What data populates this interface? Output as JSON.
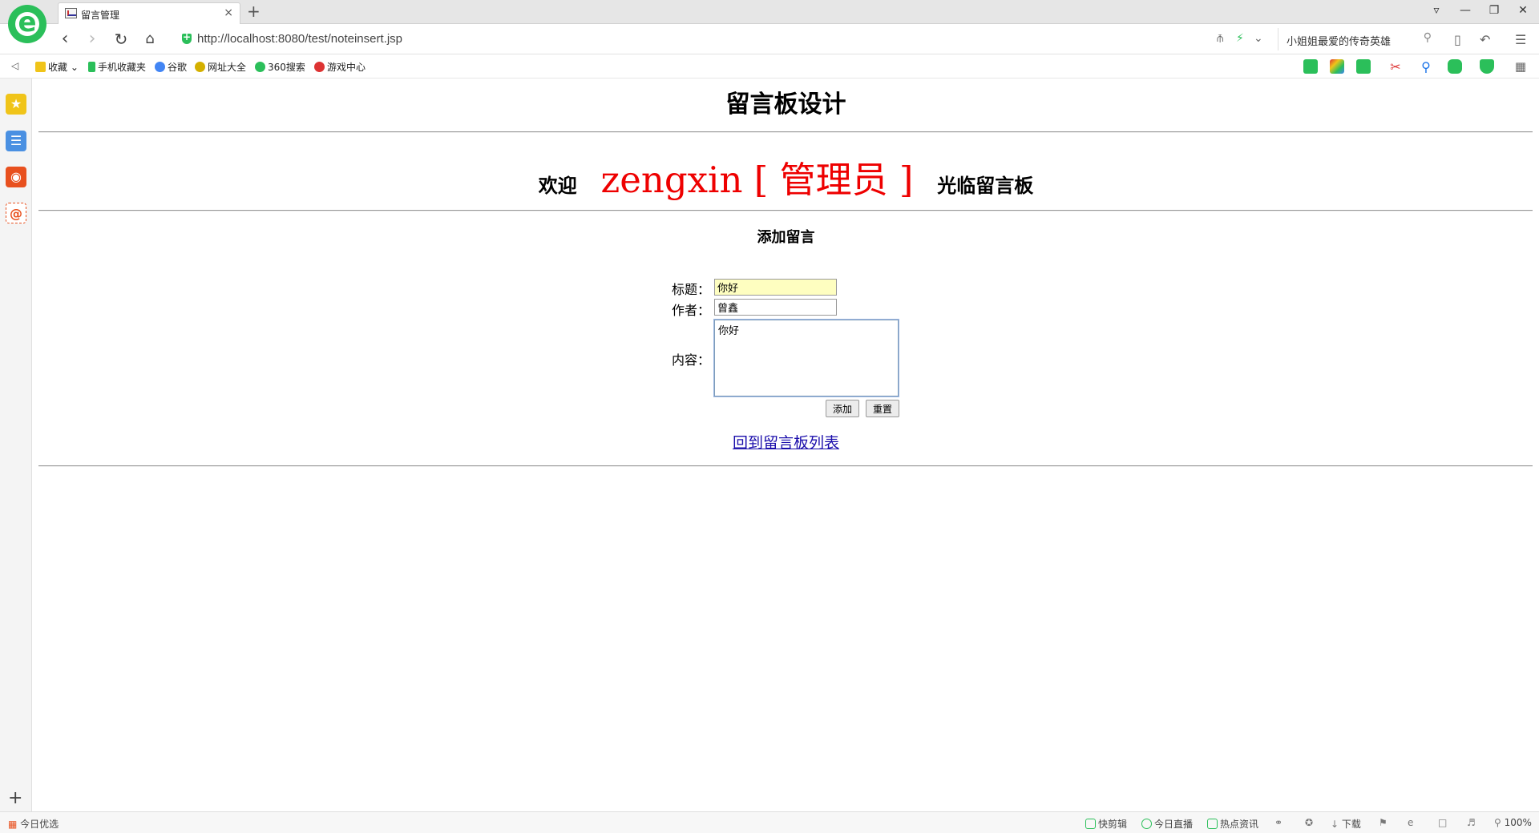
{
  "browser": {
    "tab": {
      "title": "留言管理",
      "close": "×"
    },
    "new_tab": "+",
    "url_host": "http://localhost",
    "url_rest": ":8080/test/noteinsert.jsp",
    "search_text": "小姐姐最爱的传奇英雄",
    "window_buttons": [
      "⌂",
      "—",
      "❐",
      "✕"
    ],
    "bookmarks": [
      "收藏",
      "手机收藏夹",
      "谷歌",
      "网址大全",
      "360搜索",
      "游戏中心"
    ],
    "bookmark_colors": [
      "#f0c419",
      "#2bbf5a",
      "#4285f4",
      "#d4b000",
      "#2bbf5a",
      "#d33"
    ],
    "status_left": "今日优选",
    "status_items": [
      "快剪辑",
      "今日直播",
      "热点资讯",
      "下载",
      "100%"
    ]
  },
  "page": {
    "title": "留言板设计",
    "welcome": {
      "prefix": "欢迎",
      "user": "zengxin [ 管理员 ]",
      "suffix": "光临留言板"
    },
    "section_title": "添加留言",
    "form": {
      "title_label": "标题：",
      "title_value": "你好",
      "author_label": "作者：",
      "author_value": "曾鑫",
      "content_label": "内容：",
      "content_value": "你好",
      "add_button": "添加",
      "reset_button": "重置"
    },
    "back_link": "回到留言板列表"
  },
  "colors": {
    "brand": "#2bbf5a",
    "welcome_user": "#e00000",
    "title_input_bg": "#fefec0",
    "link": "#1a0dab"
  }
}
